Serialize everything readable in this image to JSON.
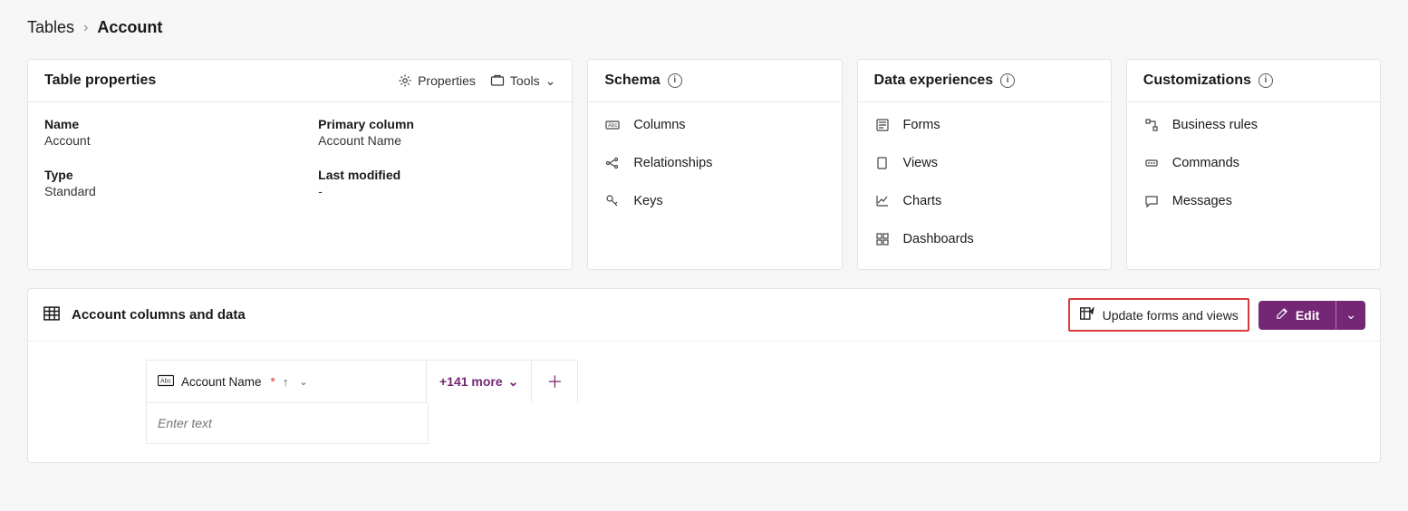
{
  "breadcrumb": {
    "parent": "Tables",
    "current": "Account"
  },
  "table_properties": {
    "title": "Table properties",
    "actions": {
      "properties": "Properties",
      "tools": "Tools"
    },
    "fields": {
      "name_label": "Name",
      "name_value": "Account",
      "primary_column_label": "Primary column",
      "primary_column_value": "Account Name",
      "type_label": "Type",
      "type_value": "Standard",
      "last_modified_label": "Last modified",
      "last_modified_value": "-"
    }
  },
  "schema": {
    "title": "Schema",
    "items": {
      "columns": "Columns",
      "relationships": "Relationships",
      "keys": "Keys"
    }
  },
  "data_experiences": {
    "title": "Data experiences",
    "items": {
      "forms": "Forms",
      "views": "Views",
      "charts": "Charts",
      "dashboards": "Dashboards"
    }
  },
  "customizations": {
    "title": "Customizations",
    "items": {
      "business_rules": "Business rules",
      "commands": "Commands",
      "messages": "Messages"
    }
  },
  "data_section": {
    "title": "Account columns and data",
    "update_label": "Update forms and views",
    "edit_label": "Edit",
    "column_header": "Account Name",
    "more_label": "+141 more",
    "input_placeholder": "Enter text"
  }
}
